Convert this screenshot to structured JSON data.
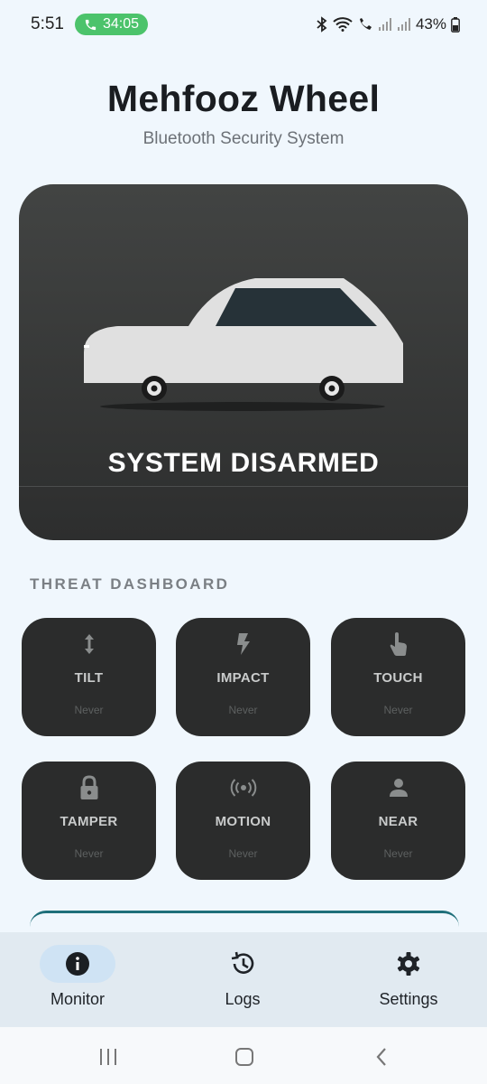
{
  "status_bar": {
    "time": "5:51",
    "call_timer": "34:05",
    "battery": "43%",
    "icons": [
      "bluetooth-icon",
      "wifi-icon",
      "wifi-call-icon",
      "signal-icon",
      "signal-icon",
      "battery-icon"
    ]
  },
  "header": {
    "title": "Mehfooz Wheel",
    "subtitle": "Bluetooth Security System"
  },
  "hero": {
    "status": "SYSTEM DISARMED",
    "car_body_color": "#e0e0e0",
    "car_window_color": "#263238"
  },
  "dashboard": {
    "label": "THREAT DASHBOARD",
    "tiles": [
      {
        "label": "TILT",
        "value": "Never",
        "icon": "vertical-arrows-icon"
      },
      {
        "label": "IMPACT",
        "value": "Never",
        "icon": "lightning-icon"
      },
      {
        "label": "TOUCH",
        "value": "Never",
        "icon": "touch-hand-icon"
      },
      {
        "label": "TAMPER",
        "value": "Never",
        "icon": "lock-icon"
      },
      {
        "label": "MOTION",
        "value": "Never",
        "icon": "radar-waves-icon"
      },
      {
        "label": "NEAR",
        "value": "Never",
        "icon": "person-icon"
      }
    ]
  },
  "bottom_nav": {
    "items": [
      {
        "label": "Monitor",
        "icon": "info-icon",
        "active": true
      },
      {
        "label": "Logs",
        "icon": "history-icon",
        "active": false
      },
      {
        "label": "Settings",
        "icon": "gear-icon",
        "active": false
      }
    ]
  },
  "colors": {
    "background": "#f0f7fd",
    "card": "#2b2c2c",
    "accent_teal": "#1f6f7a",
    "nav_active": "#cfe3f4",
    "call_green": "#4cc36b"
  }
}
